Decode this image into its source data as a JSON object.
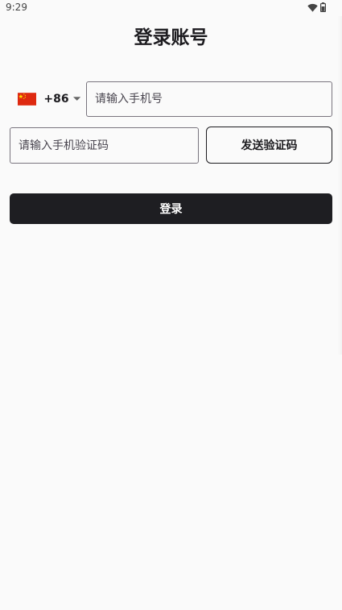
{
  "status_bar": {
    "time": "9:29",
    "icons": [
      "wifi-icon",
      "battery-icon"
    ]
  },
  "page": {
    "title": "登录账号"
  },
  "country_picker": {
    "flag": "china-flag-icon",
    "dial_code": "+86",
    "arrow": "dropdown-arrow-icon"
  },
  "phone_input": {
    "value": "",
    "placeholder": "请输入手机号"
  },
  "code_input": {
    "value": "",
    "placeholder": "请输入手机验证码"
  },
  "buttons": {
    "send_code": "发送验证码",
    "login": "登录"
  },
  "colors": {
    "background": "#fafafa",
    "primary": "#1e1e22",
    "outline": "#79747e",
    "flag_red": "#de2910",
    "flag_yellow": "#ffde00"
  }
}
